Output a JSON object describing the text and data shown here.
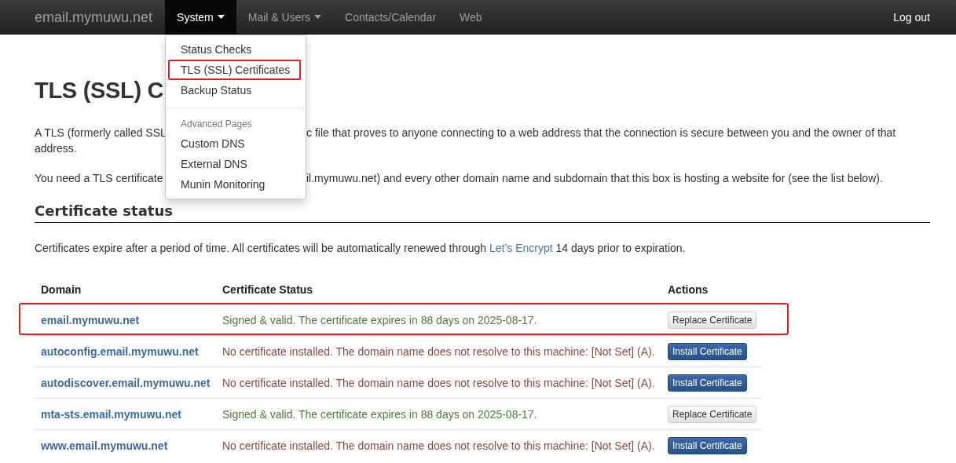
{
  "navbar": {
    "brand": "email.mymuwu.net",
    "items": [
      {
        "label": "System",
        "dropdown": true,
        "selected": true
      },
      {
        "label": "Mail & Users",
        "dropdown": true,
        "selected": false
      },
      {
        "label": "Contacts/Calendar",
        "dropdown": false,
        "selected": false
      },
      {
        "label": "Web",
        "dropdown": false,
        "selected": false
      }
    ],
    "logout": "Log out"
  },
  "system_menu": {
    "items": [
      {
        "kind": "item",
        "label": "Status Checks",
        "highlighted": false
      },
      {
        "kind": "item",
        "label": "TLS (SSL) Certificates",
        "highlighted": true
      },
      {
        "kind": "item",
        "label": "Backup Status",
        "highlighted": false
      },
      {
        "kind": "divider"
      },
      {
        "kind": "header",
        "label": "Advanced Pages"
      },
      {
        "kind": "item",
        "label": "Custom DNS",
        "highlighted": false
      },
      {
        "kind": "item",
        "label": "External DNS",
        "highlighted": false
      },
      {
        "kind": "item",
        "label": "Munin Monitoring",
        "highlighted": false
      }
    ]
  },
  "title": "TLS (SSL) C",
  "intro": [
    {
      "left": "A TLS (formerly called SSL",
      "right": "c file that proves to anyone connecting to a web address that the connection is secure between you and the owner of that",
      "continued": "address."
    },
    {
      "left": "You need a TLS certificate",
      "right": "il.mymuwu.net) and every other domain name and subdomain that this box is hosting a website for (see the list below)."
    }
  ],
  "section": {
    "heading": "Certificate status",
    "note_before": "Certificates expire after a period of time. All certificates will be automatically renewed through",
    "note_link": "Let’s Encrypt",
    "note_after": "14 days prior to expiration."
  },
  "table": {
    "columns": [
      "Domain",
      "Certificate Status",
      "Actions"
    ],
    "rows": [
      {
        "domain": "email.mymuwu.net",
        "status": "Signed & valid. The certificate expires in 88 days on 2025-08-17.",
        "kind": "valid",
        "action": "Replace Certificate",
        "highlighted": true
      },
      {
        "domain": "autoconfig.email.mymuwu.net",
        "status": "No certificate installed. The domain name does not resolve to this machine: [Not Set] (A).",
        "kind": "missing",
        "action": "Install Certificate",
        "highlighted": false
      },
      {
        "domain": "autodiscover.email.mymuwu.net",
        "status": "No certificate installed. The domain name does not resolve to this machine: [Not Set] (A).",
        "kind": "missing",
        "action": "Install Certificate",
        "highlighted": false
      },
      {
        "domain": "mta-sts.email.mymuwu.net",
        "status": "Signed & valid. The certificate expires in 88 days on 2025-08-17.",
        "kind": "valid",
        "action": "Replace Certificate",
        "highlighted": false
      },
      {
        "domain": "www.email.mymuwu.net",
        "status": "No certificate installed. The domain name does not resolve to this machine: [Not Set] (A).",
        "kind": "missing",
        "action": "Install Certificate",
        "highlighted": false
      }
    ]
  }
}
